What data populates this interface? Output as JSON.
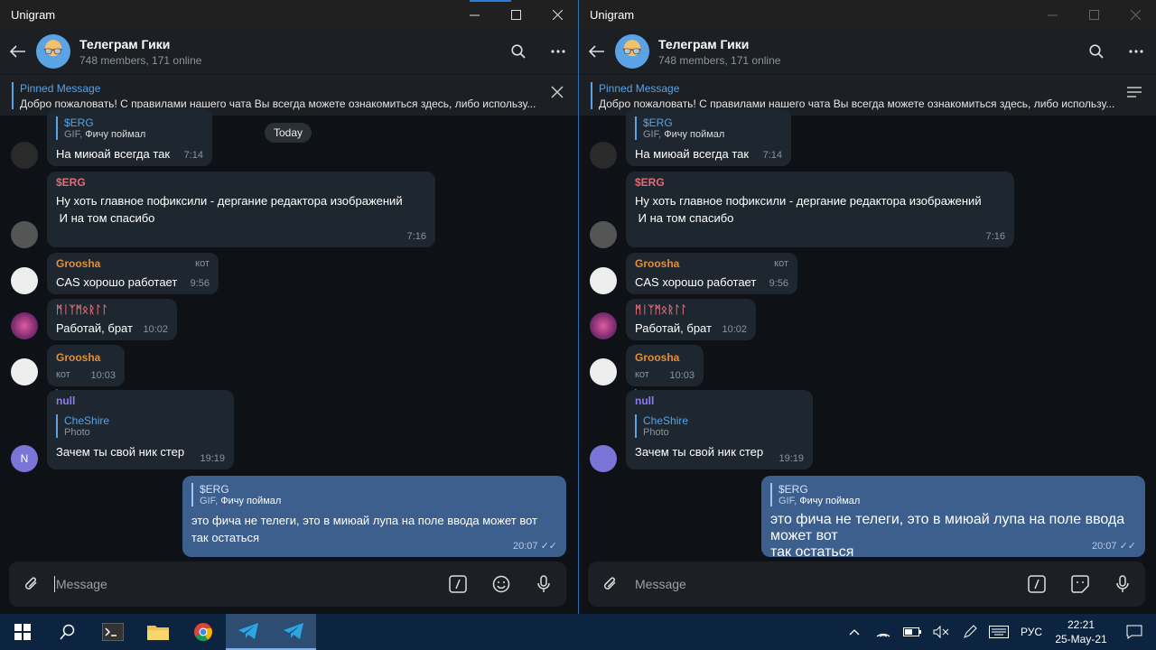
{
  "app": {
    "title": "Unigram"
  },
  "chat": {
    "title": "Телеграм Гики",
    "subtitle": "748 members, 171 online"
  },
  "pinned": {
    "label": "Pinned Message",
    "text": "Добро пожаловать! С правилами нашего чата Вы всегда можете ознакомиться здесь, либо использу..."
  },
  "date_badge": "Today",
  "messages": {
    "m1": {
      "reply_name": "$ERG",
      "reply_kind": "GIF,",
      "reply_text": "Фичу поймал",
      "text": "На миюай всегда так",
      "time": "7:14"
    },
    "m2": {
      "name": "$ERG",
      "line1": "Ну хоть главное пофиксили - дергание редактора изображений",
      "line2": " И на том спасибо",
      "time": "7:16"
    },
    "m3": {
      "name": "Groosha",
      "tag": "кот",
      "text": "CAS хорошо работает",
      "time": "9:56"
    },
    "m4": {
      "name": "ᛗᛁᛉᛗᛟᚱᛚᛚ",
      "text": "Работай, брат",
      "time": "10:02"
    },
    "m5": {
      "name": "Groosha",
      "tag": "кот",
      "text": ")",
      "time": "10:03"
    },
    "m6": {
      "name": "null",
      "avatar_letter": "N",
      "reply_name": "CheShire",
      "reply_text": "Photo",
      "text": "Зачем ты свой ник стер",
      "time": "19:19"
    },
    "m7": {
      "reply_name": "$ERG",
      "reply_kind": "GIF,",
      "reply_text": "Фичу поймал",
      "line1": "это фича не телеги, это в миюай лупа на поле ввода может вот",
      "line2": "так остаться",
      "time": "20:07"
    }
  },
  "composer": {
    "placeholder": "Message"
  },
  "taskbar": {
    "lang": "РУС",
    "time": "22:21",
    "date": "25-May-21"
  },
  "colors": {
    "accent": "#5aa3e4",
    "own_bubble": "#3c5f8e",
    "incoming_bubble": "#1e2630",
    "name_red": "#e06c75",
    "name_orange": "#e0903a",
    "name_purple": "#8d7cf0"
  }
}
